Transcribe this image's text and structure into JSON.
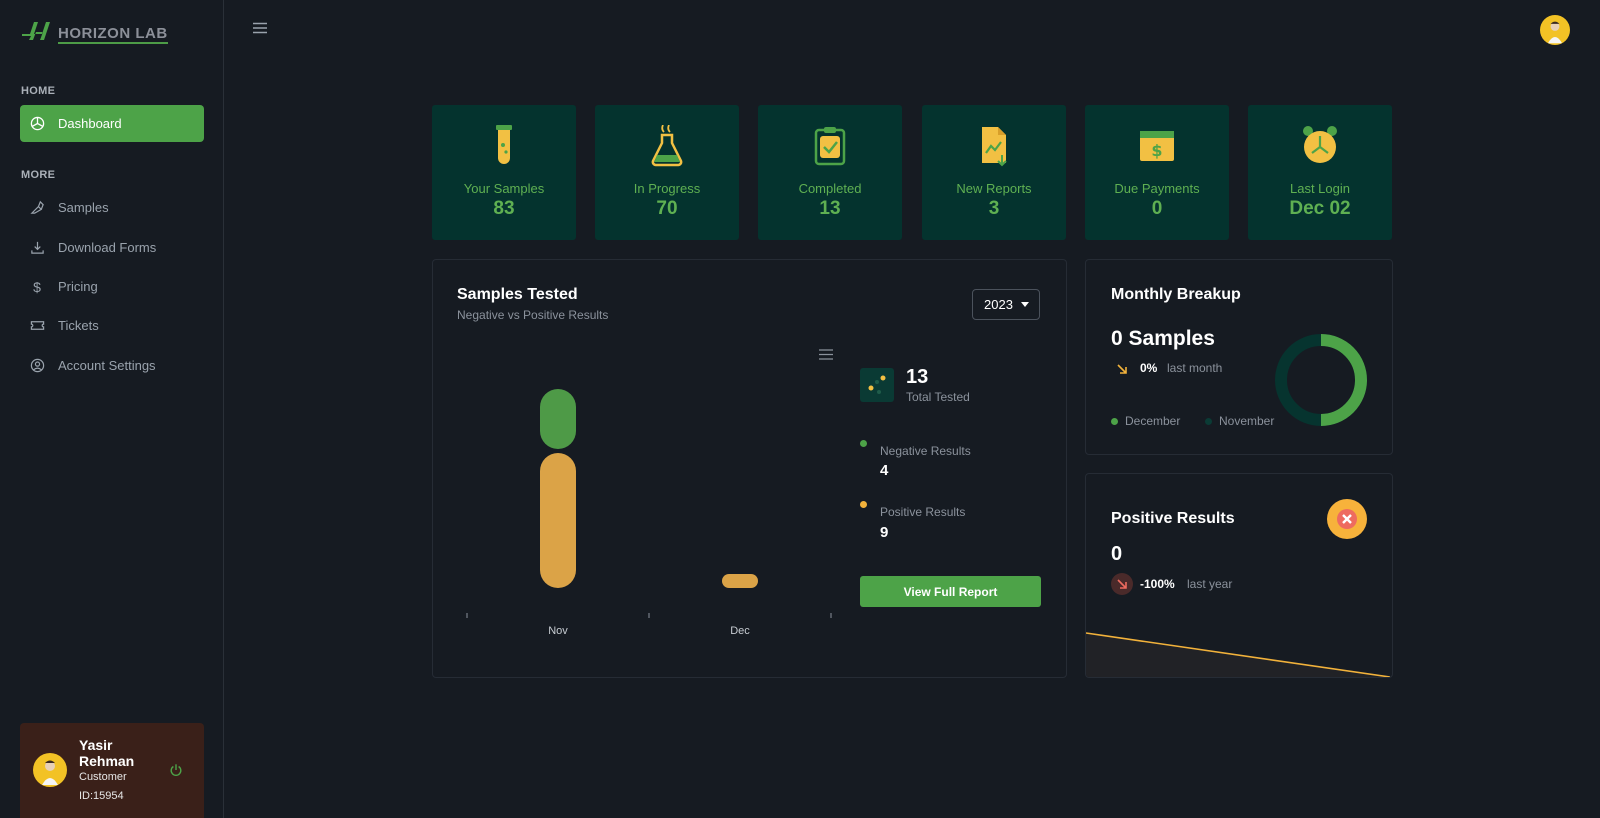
{
  "brand": {
    "name": "HORIZON LAB",
    "accent": "#4da348"
  },
  "sidebar": {
    "sections": {
      "home": "HOME",
      "more": "MORE"
    },
    "items": [
      {
        "label": "Dashboard",
        "icon": "dashboard-icon",
        "active": true
      },
      {
        "label": "Samples",
        "icon": "samples-icon"
      },
      {
        "label": "Download Forms",
        "icon": "download-icon"
      },
      {
        "label": "Pricing",
        "icon": "dollar-icon"
      },
      {
        "label": "Tickets",
        "icon": "ticket-icon"
      },
      {
        "label": "Account Settings",
        "icon": "account-icon"
      }
    ]
  },
  "user": {
    "name": "Yasir Rehman",
    "role": "Customer",
    "id": "ID:15954"
  },
  "stats": [
    {
      "label": "Your Samples",
      "value": "83",
      "icon": "test-tube-icon"
    },
    {
      "label": "In Progress",
      "value": "70",
      "icon": "flask-icon"
    },
    {
      "label": "Completed",
      "value": "13",
      "icon": "clipboard-check-icon"
    },
    {
      "label": "New Reports",
      "value": "3",
      "icon": "report-icon"
    },
    {
      "label": "Due Payments",
      "value": "0",
      "icon": "payment-icon"
    },
    {
      "label": "Last Login",
      "value": "Dec 02",
      "icon": "alarm-clock-icon"
    }
  ],
  "samples_tested": {
    "title": "Samples Tested",
    "subtitle": "Negative vs Positive Results",
    "year": "2023",
    "total_value": "13",
    "total_label": "Total Tested",
    "negative_label": "Negative Results",
    "negative_value": "4",
    "positive_label": "Positive Results",
    "positive_value": "9",
    "button": "View Full Report"
  },
  "monthly_breakup": {
    "title": "Monthly Breakup",
    "value": "0 Samples",
    "pct": "0%",
    "period": "last month",
    "legend": [
      "December",
      "November"
    ]
  },
  "positive_results": {
    "title": "Positive Results",
    "value": "0",
    "pct": "-100%",
    "period": "last year"
  },
  "chart_data": {
    "type": "bar",
    "categories": [
      "Nov",
      "Dec"
    ],
    "series": [
      {
        "values": [
          4,
          0
        ],
        "color": "#4e9a47"
      },
      {
        "values": [
          9,
          0.4
        ],
        "color": "#dba347"
      }
    ],
    "stacked": true,
    "ylim": [
      0,
      14
    ]
  }
}
